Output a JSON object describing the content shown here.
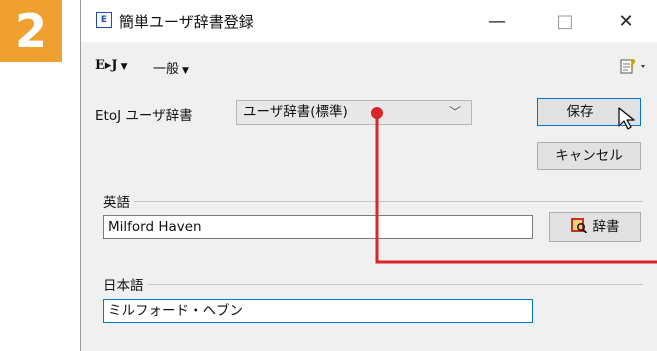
{
  "step_number": "2",
  "window": {
    "title": "簡単ユーザ辞書登録",
    "app_icon_text": "E",
    "minimize_glyph": "—",
    "maximize_glyph": "□",
    "close_glyph": "✕"
  },
  "toolbar": {
    "direction_label": "E▸J",
    "category_label": "一般"
  },
  "dictionary": {
    "label": "EtoJ ユーザ辞書",
    "selected_value": "ユーザ辞書(標準)"
  },
  "buttons": {
    "save_label": "保存",
    "cancel_label": "キャンセル",
    "dictionary_label": "辞書"
  },
  "english": {
    "label": "英語",
    "value": "Milford Haven"
  },
  "japanese": {
    "label": "日本語",
    "value": "ミルフォード・ヘブン"
  },
  "annotation_color": "#d9252b"
}
